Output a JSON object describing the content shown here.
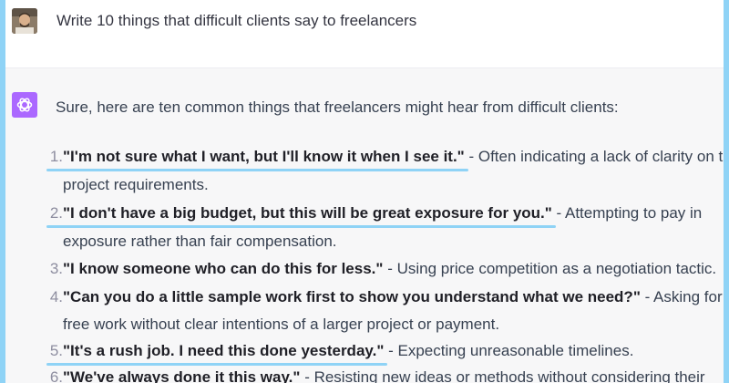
{
  "user": {
    "prompt": "Write 10 things that difficult clients say to freelancers"
  },
  "assistant": {
    "intro": "Sure, here are ten common things that freelancers might hear from difficult clients:",
    "items": [
      {
        "num": "1.",
        "quote": "\"I'm not sure what I want, but I'll know it when I see it.\"",
        "desc": " - Often indicating a lack of clarity on the",
        "cont": "project requirements."
      },
      {
        "num": "2.",
        "quote": "\"I don't have a big budget, but this will be great exposure for you.\"",
        "desc": " - Attempting to pay in",
        "cont": "exposure rather than fair compensation."
      },
      {
        "num": "3.",
        "quote": "\"I know someone who can do this for less.\"",
        "desc": " - Using price competition as a negotiation tactic."
      },
      {
        "num": "4.",
        "quote": "\"Can you do a little sample work first to show you understand what we need?\"",
        "desc": " - Asking for",
        "cont": "free work without clear intentions of a larger project or payment."
      },
      {
        "num": "5.",
        "quote": "\"It's a rush job. I need this done yesterday.\"",
        "desc": " - Expecting unreasonable timelines."
      },
      {
        "num": "6.",
        "quote": "\"We've always done it this way.\"",
        "desc": " - Resisting new ideas or methods without considering their"
      }
    ]
  },
  "colors": {
    "page_border": "#8fd3f6",
    "highlight_underline": "#8fd3f6",
    "assistant_bg": "#f7f7f8",
    "gpt_avatar": "#ab68ff"
  },
  "icons": {
    "user_avatar": "user-photo-avatar",
    "assistant_avatar": "openai-logo-icon"
  }
}
